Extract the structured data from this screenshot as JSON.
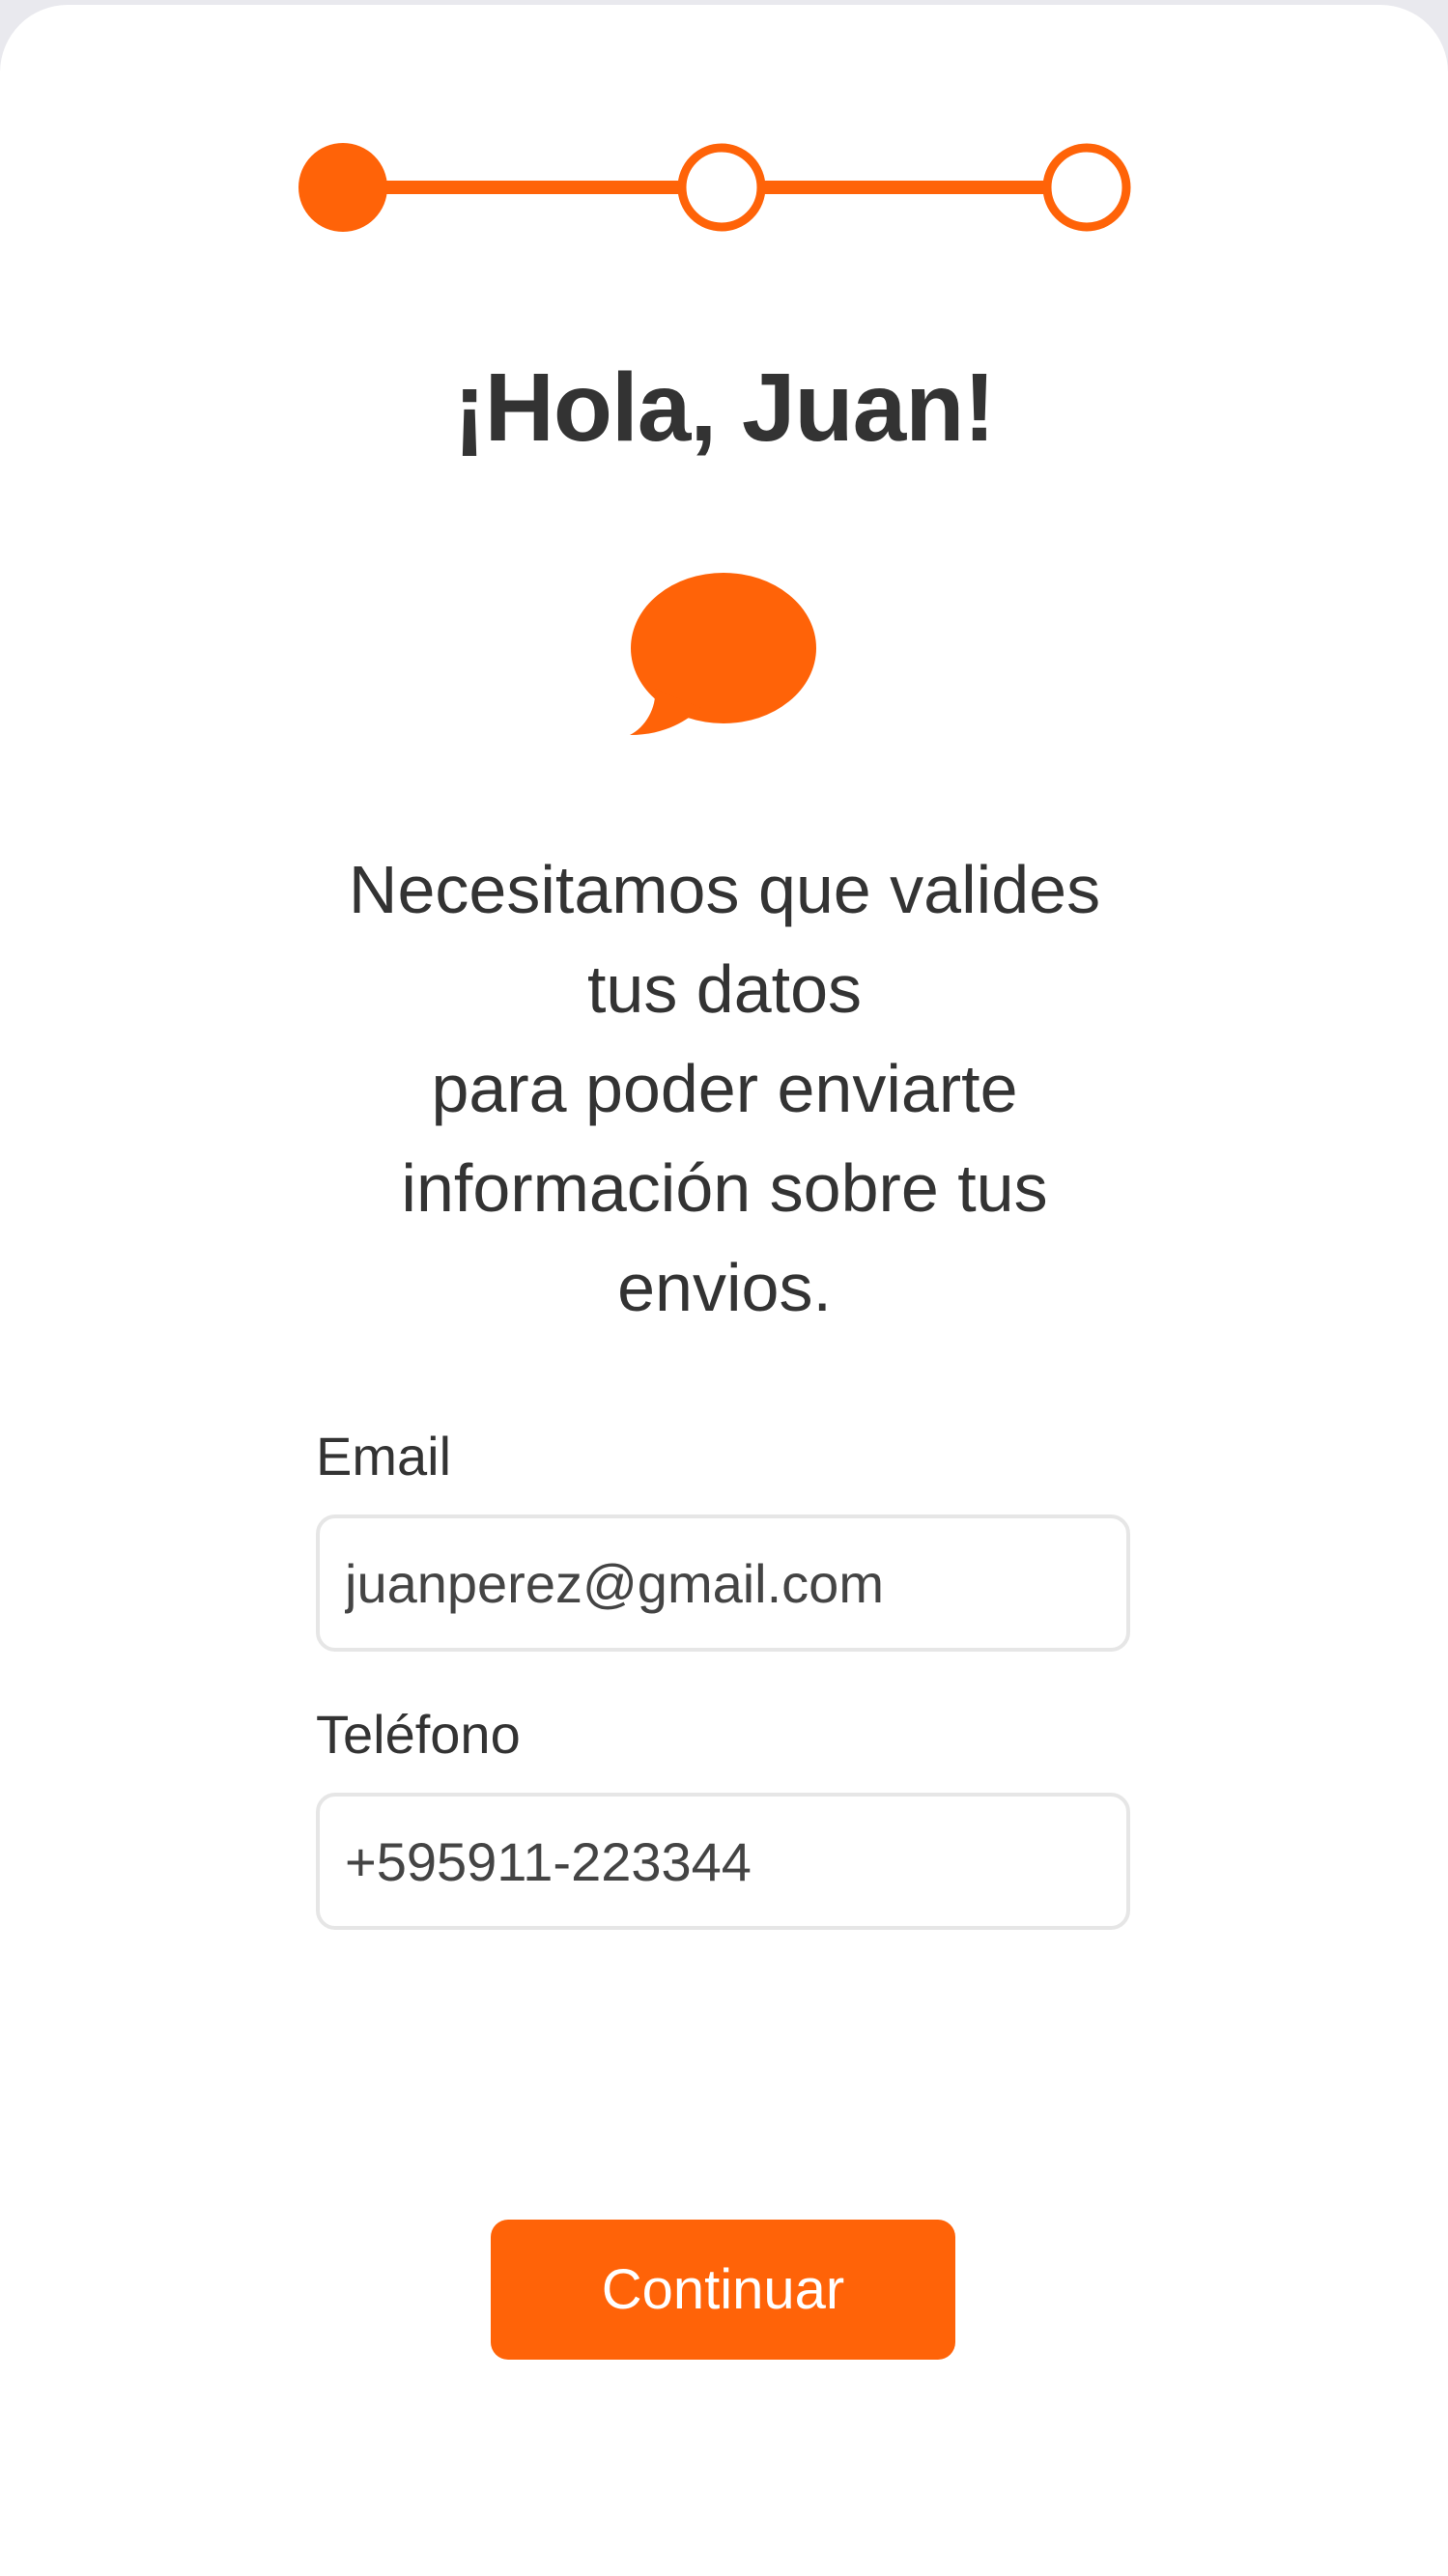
{
  "colors": {
    "accent": "#ff6308",
    "text": "#333333",
    "input_border": "#e6e6e6"
  },
  "stepper": {
    "steps": [
      {
        "state": "active"
      },
      {
        "state": "inactive"
      },
      {
        "state": "inactive"
      }
    ]
  },
  "header": {
    "title": "¡Hola, Juan!"
  },
  "icon": {
    "name": "chat-bubble-icon"
  },
  "message": {
    "lines": [
      "Necesitamos que valides",
      "tus datos",
      "para poder enviarte",
      "información sobre tus",
      "envios."
    ]
  },
  "form": {
    "email": {
      "label": "Email",
      "value": "juanperez@gmail.com"
    },
    "phone": {
      "label": "Teléfono",
      "value": "+595911-223344"
    }
  },
  "actions": {
    "continue_label": "Continuar"
  }
}
